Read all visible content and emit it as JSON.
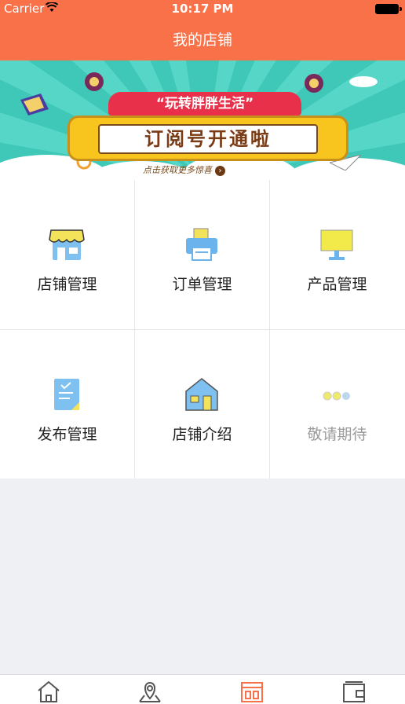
{
  "status_bar": {
    "carrier": "Carrier",
    "time": "10:17 PM"
  },
  "nav": {
    "title": "我的店铺"
  },
  "banner": {
    "tagline": "“玩转胖胖生活”",
    "headline": "订阅号开通啦",
    "footer": "点击获取更多惊喜"
  },
  "grid": {
    "items": [
      {
        "label": "店铺管理",
        "icon": "storefront-icon"
      },
      {
        "label": "订单管理",
        "icon": "printer-icon"
      },
      {
        "label": "产品管理",
        "icon": "signboard-icon"
      },
      {
        "label": "发布管理",
        "icon": "document-icon"
      },
      {
        "label": "店铺介绍",
        "icon": "house-icon"
      },
      {
        "label": "敬请期待",
        "icon": "dots-icon"
      }
    ]
  },
  "tabbar": {
    "tabs": [
      {
        "icon": "home-icon",
        "active": false
      },
      {
        "icon": "location-icon",
        "active": false
      },
      {
        "icon": "shop-icon",
        "active": true
      },
      {
        "icon": "wallet-icon",
        "active": false
      }
    ],
    "active_color": "#f87149",
    "inactive_color": "#555555"
  },
  "colors": {
    "accent": "#f87149",
    "background": "#eef0f4"
  }
}
